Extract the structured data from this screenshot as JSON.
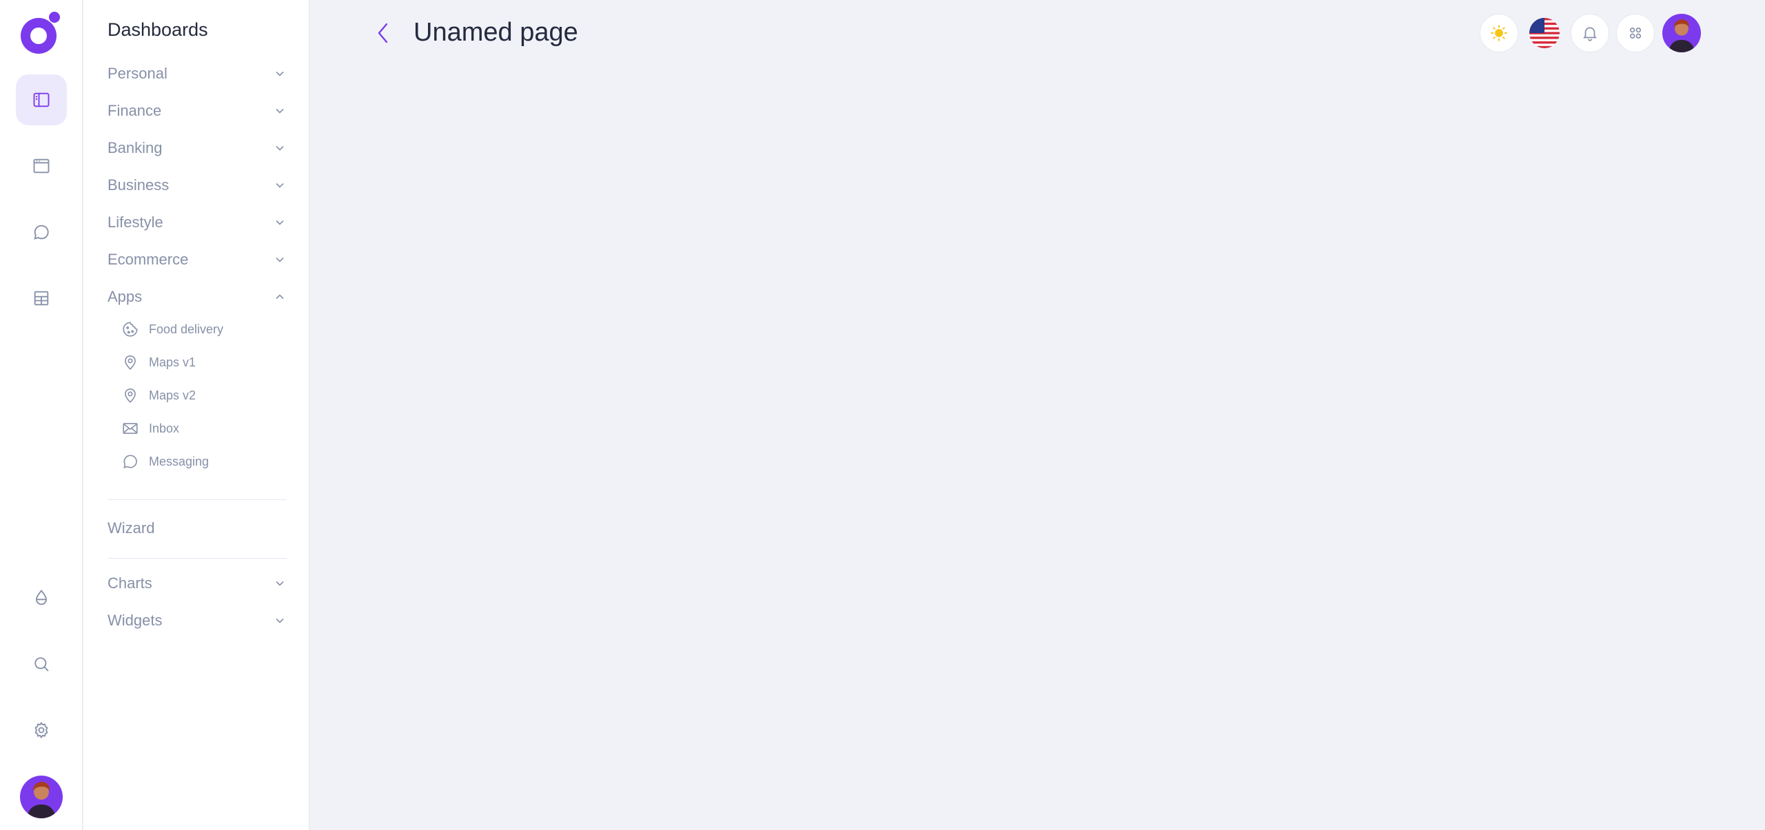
{
  "sidebar": {
    "title": "Dashboards",
    "items": [
      {
        "label": "Personal"
      },
      {
        "label": "Finance"
      },
      {
        "label": "Banking"
      },
      {
        "label": "Business"
      },
      {
        "label": "Lifestyle"
      },
      {
        "label": "Ecommerce"
      },
      {
        "label": "Apps"
      }
    ],
    "apps": [
      {
        "label": "Food delivery",
        "icon": "cookie-icon"
      },
      {
        "label": "Maps v1",
        "icon": "map-pin-icon"
      },
      {
        "label": "Maps v2",
        "icon": "map-pin-icon"
      },
      {
        "label": "Inbox",
        "icon": "envelope-icon"
      },
      {
        "label": "Messaging",
        "icon": "chat-bubble-icon"
      }
    ],
    "wizard": "Wizard",
    "charts": "Charts",
    "widgets": "Widgets"
  },
  "header": {
    "title": "Unamed page"
  },
  "colors": {
    "accent": "#7c3aed",
    "background": "#f0f2f8",
    "muted_text": "#8790a8"
  }
}
